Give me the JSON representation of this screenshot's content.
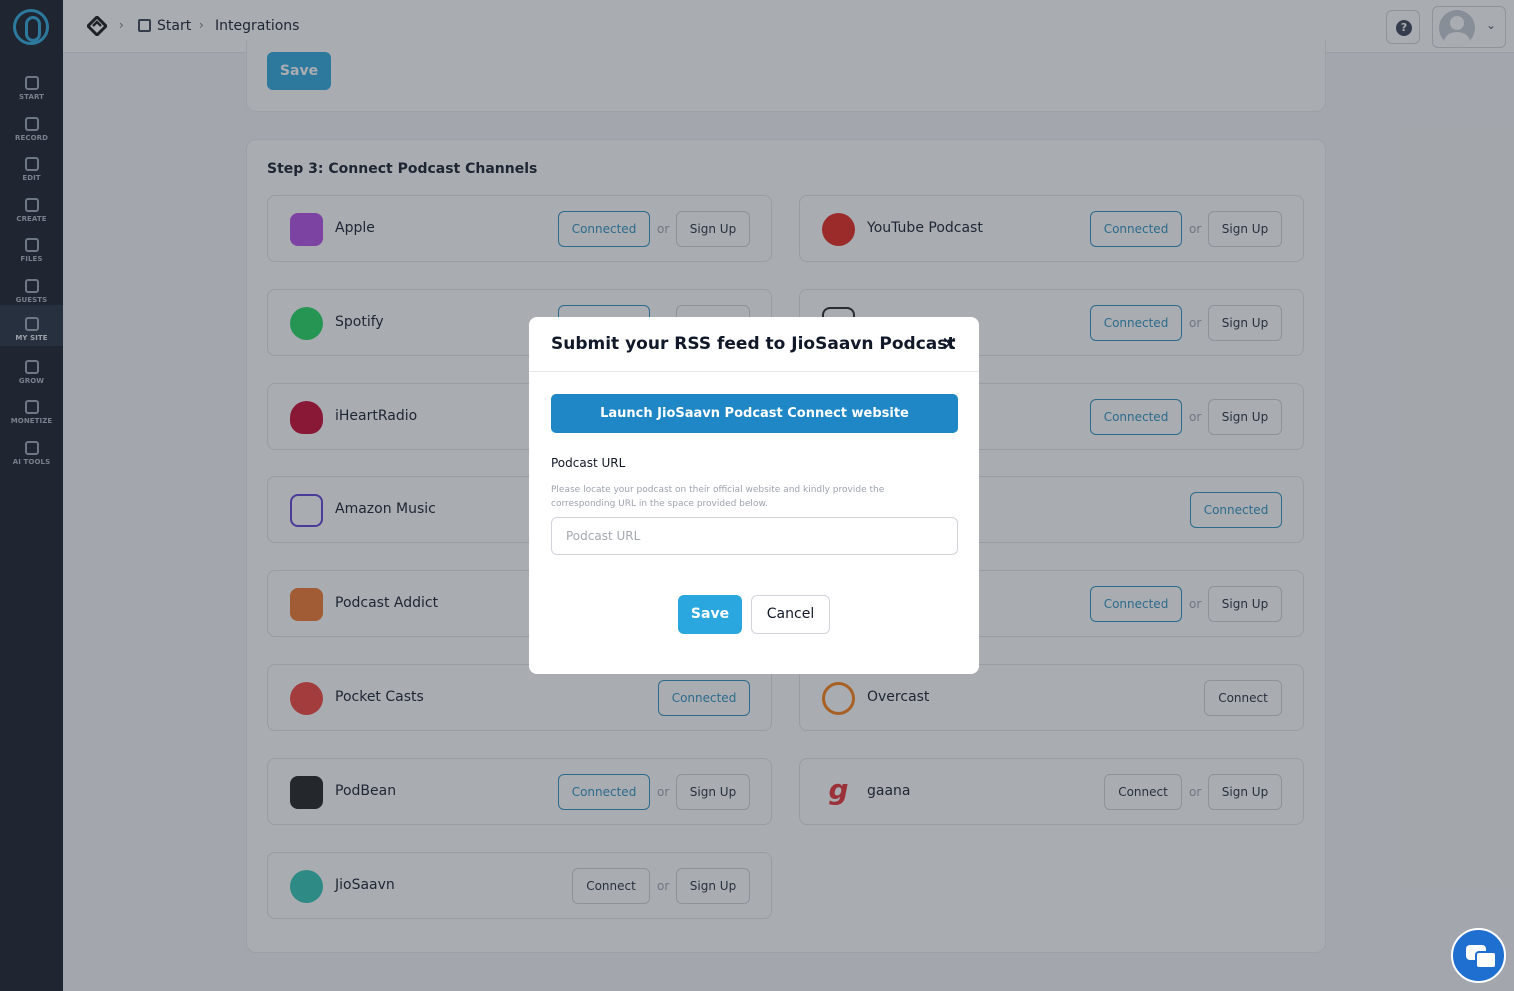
{
  "sidebar": {
    "items": [
      {
        "label": "START"
      },
      {
        "label": "RECORD"
      },
      {
        "label": "EDIT"
      },
      {
        "label": "CREATE"
      },
      {
        "label": "FILES"
      },
      {
        "label": "GUESTS"
      },
      {
        "label": "MY SITE"
      },
      {
        "label": "GROW"
      },
      {
        "label": "MONETIZE"
      },
      {
        "label": "AI TOOLS"
      }
    ]
  },
  "breadcrumb": {
    "home": "Start",
    "current": "Integrations"
  },
  "topbar": {
    "help": "?"
  },
  "top_save_label": "Save",
  "step_title": "Step 3: Connect Podcast Channels",
  "labels": {
    "connected": "Connected",
    "connect": "Connect",
    "sign_up": "Sign Up",
    "or": "or"
  },
  "channels_left": [
    {
      "name": "Apple"
    },
    {
      "name": "Spotify"
    },
    {
      "name": "iHeartRadio"
    },
    {
      "name": "Amazon Music"
    },
    {
      "name": "Podcast Addict"
    },
    {
      "name": "Pocket Casts"
    },
    {
      "name": "PodBean"
    },
    {
      "name": "JioSaavn"
    }
  ],
  "channels_right": [
    {
      "name": "YouTube Podcast"
    },
    {
      "name": "Overcast"
    },
    {
      "name": "gaana"
    }
  ],
  "modal": {
    "title": "Submit your RSS feed to JioSaavn Podcast",
    "close": "×",
    "launch_label": "Launch JioSaavn Podcast Connect website",
    "field_label": "Podcast URL",
    "field_help": "Please locate your podcast on their official website and kindly provide the corresponding URL in the space provided below.",
    "placeholder": "Podcast URL",
    "value": "",
    "save_label": "Save",
    "cancel_label": "Cancel"
  },
  "colors": {
    "accent": "#2aa7df",
    "launch": "#1f87c6",
    "sidebar": "#121923"
  }
}
